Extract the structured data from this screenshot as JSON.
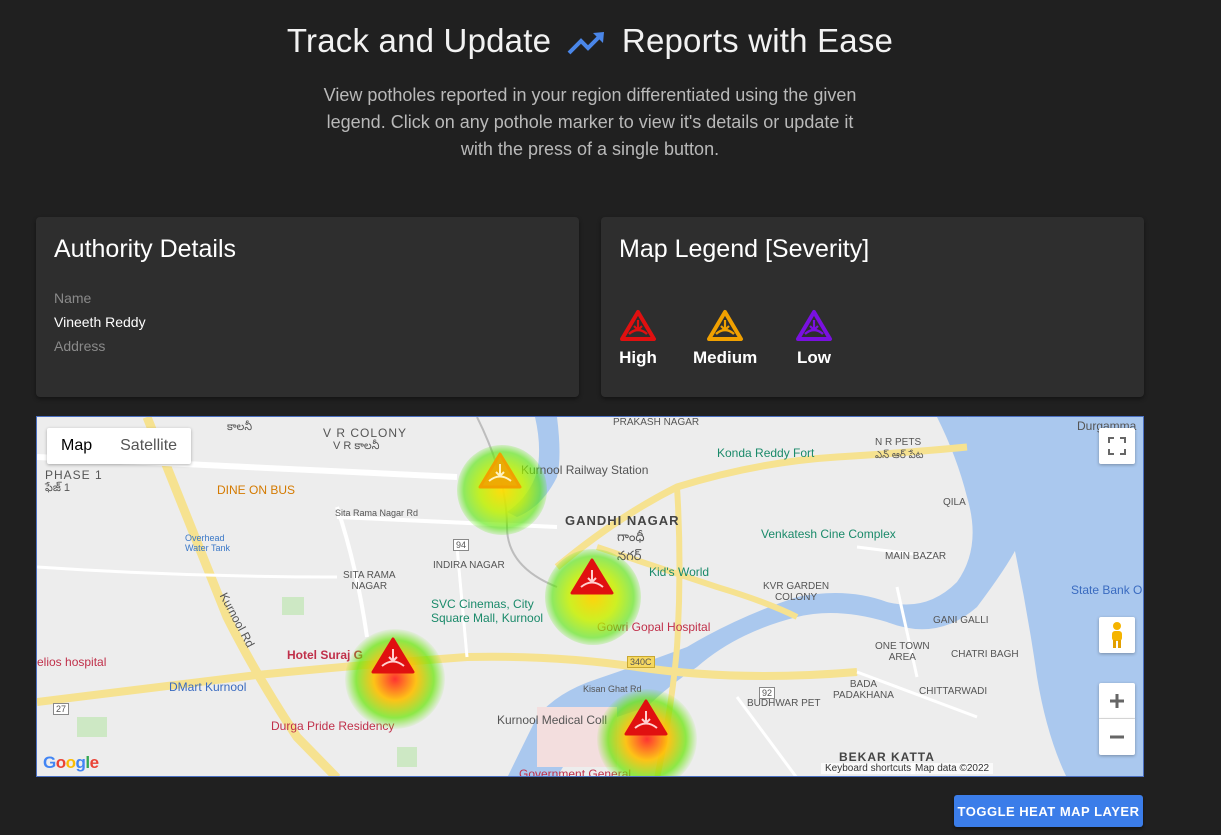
{
  "hero": {
    "title_left": "Track and Update",
    "title_right": "Reports with Ease",
    "title_icon": "trending-up-icon",
    "subtitle": "View potholes reported in your region differentiated using the given legend. Click on any pothole marker to view it's details or update it with the press of a single button."
  },
  "authority": {
    "title": "Authority Details",
    "name_label": "Name",
    "name_value": "Vineeth Reddy",
    "address_label": "Address",
    "address_value": ""
  },
  "legend": {
    "title": "Map Legend [Severity]",
    "items": [
      {
        "label": "High",
        "color": "#e01010",
        "icon": "pothole-warning-icon"
      },
      {
        "label": "Medium",
        "color": "#f0a000",
        "icon": "pothole-warning-icon"
      },
      {
        "label": "Low",
        "color": "#7a10e0",
        "icon": "pothole-warning-icon"
      }
    ]
  },
  "map": {
    "type_options": [
      "Map",
      "Satellite"
    ],
    "selected_type": "Map",
    "labels": {
      "vr_colony": "V R COLONY",
      "vr_colony_te": "V R కాలనీ",
      "colony_te_top": "కాలనీ",
      "phase1": "PHASE 1",
      "phase1_te": "ఫేజ్ 1",
      "dine_on_bus": "DINE ON BUS",
      "overhead_tank": "Overhead\nWater Tank",
      "kurnool_rd": "Kurnool Rd",
      "sita_rama_nagar_rd": "Sita Rama Nagar Rd",
      "sita_rama_nagar": "SITA RAMA\nNAGAR",
      "indira_nagar": "INDIRA NAGAR",
      "kurnool_railway": "Kurnool Railway Station",
      "gandhi_nagar": "GANDHI NAGAR",
      "gandhi_nagar_te": "గాంధీ\nనగర్",
      "prakash_nagar": "PRAKASH NAGAR",
      "nr_pets": "N R PETS",
      "nr_pets_te": "ఎన్ ఆర్ పేట",
      "konda_reddy_fort": "Konda Reddy Fort",
      "qila": "QILA",
      "venkatesh_cine": "Venkatesh Cine Complex",
      "kids_world": "Kid's World",
      "kvr_garden": "KVR GARDEN\nCOLONY",
      "main_bazar": "MAIN BAZAR",
      "state_bank": "State Bank O",
      "svc_cinemas": "SVC Cinemas, City\nSquare Mall, Kurnool",
      "gowri_gopal": "Gowri Gopal Hospital",
      "helios": "elios hospital",
      "hotel_suraj": "Hotel Suraj G",
      "dmart": "DMart Kurnool",
      "durga_pride": "Durga Pride Residency",
      "kurnool_medical": "Kurnool Medical Coll",
      "govt_general": "Government General",
      "kisan_ghat": "Kisan Ghat Rd",
      "budhwar_pet": "BUDHWAR PET",
      "bada_padakhana": "BADA\nPADAKHANA",
      "chittarwadi": "CHITTARWADI",
      "one_town": "ONE TOWN\nAREA",
      "chatri_bagh": "CHATRI BAGH",
      "gani_galli": "GANI GALLI",
      "bekar_katta": "BEKAR KATTA",
      "durgamma": "Durgamma",
      "route_94": "94",
      "route_92": "92",
      "route_27": "27",
      "route_340c": "340C"
    },
    "attribution": {
      "shortcuts": "Keyboard shortcuts",
      "data": "Map data ©2022"
    },
    "google": "Google"
  },
  "toggle_button": "TOGGLE HEAT MAP LAYER"
}
